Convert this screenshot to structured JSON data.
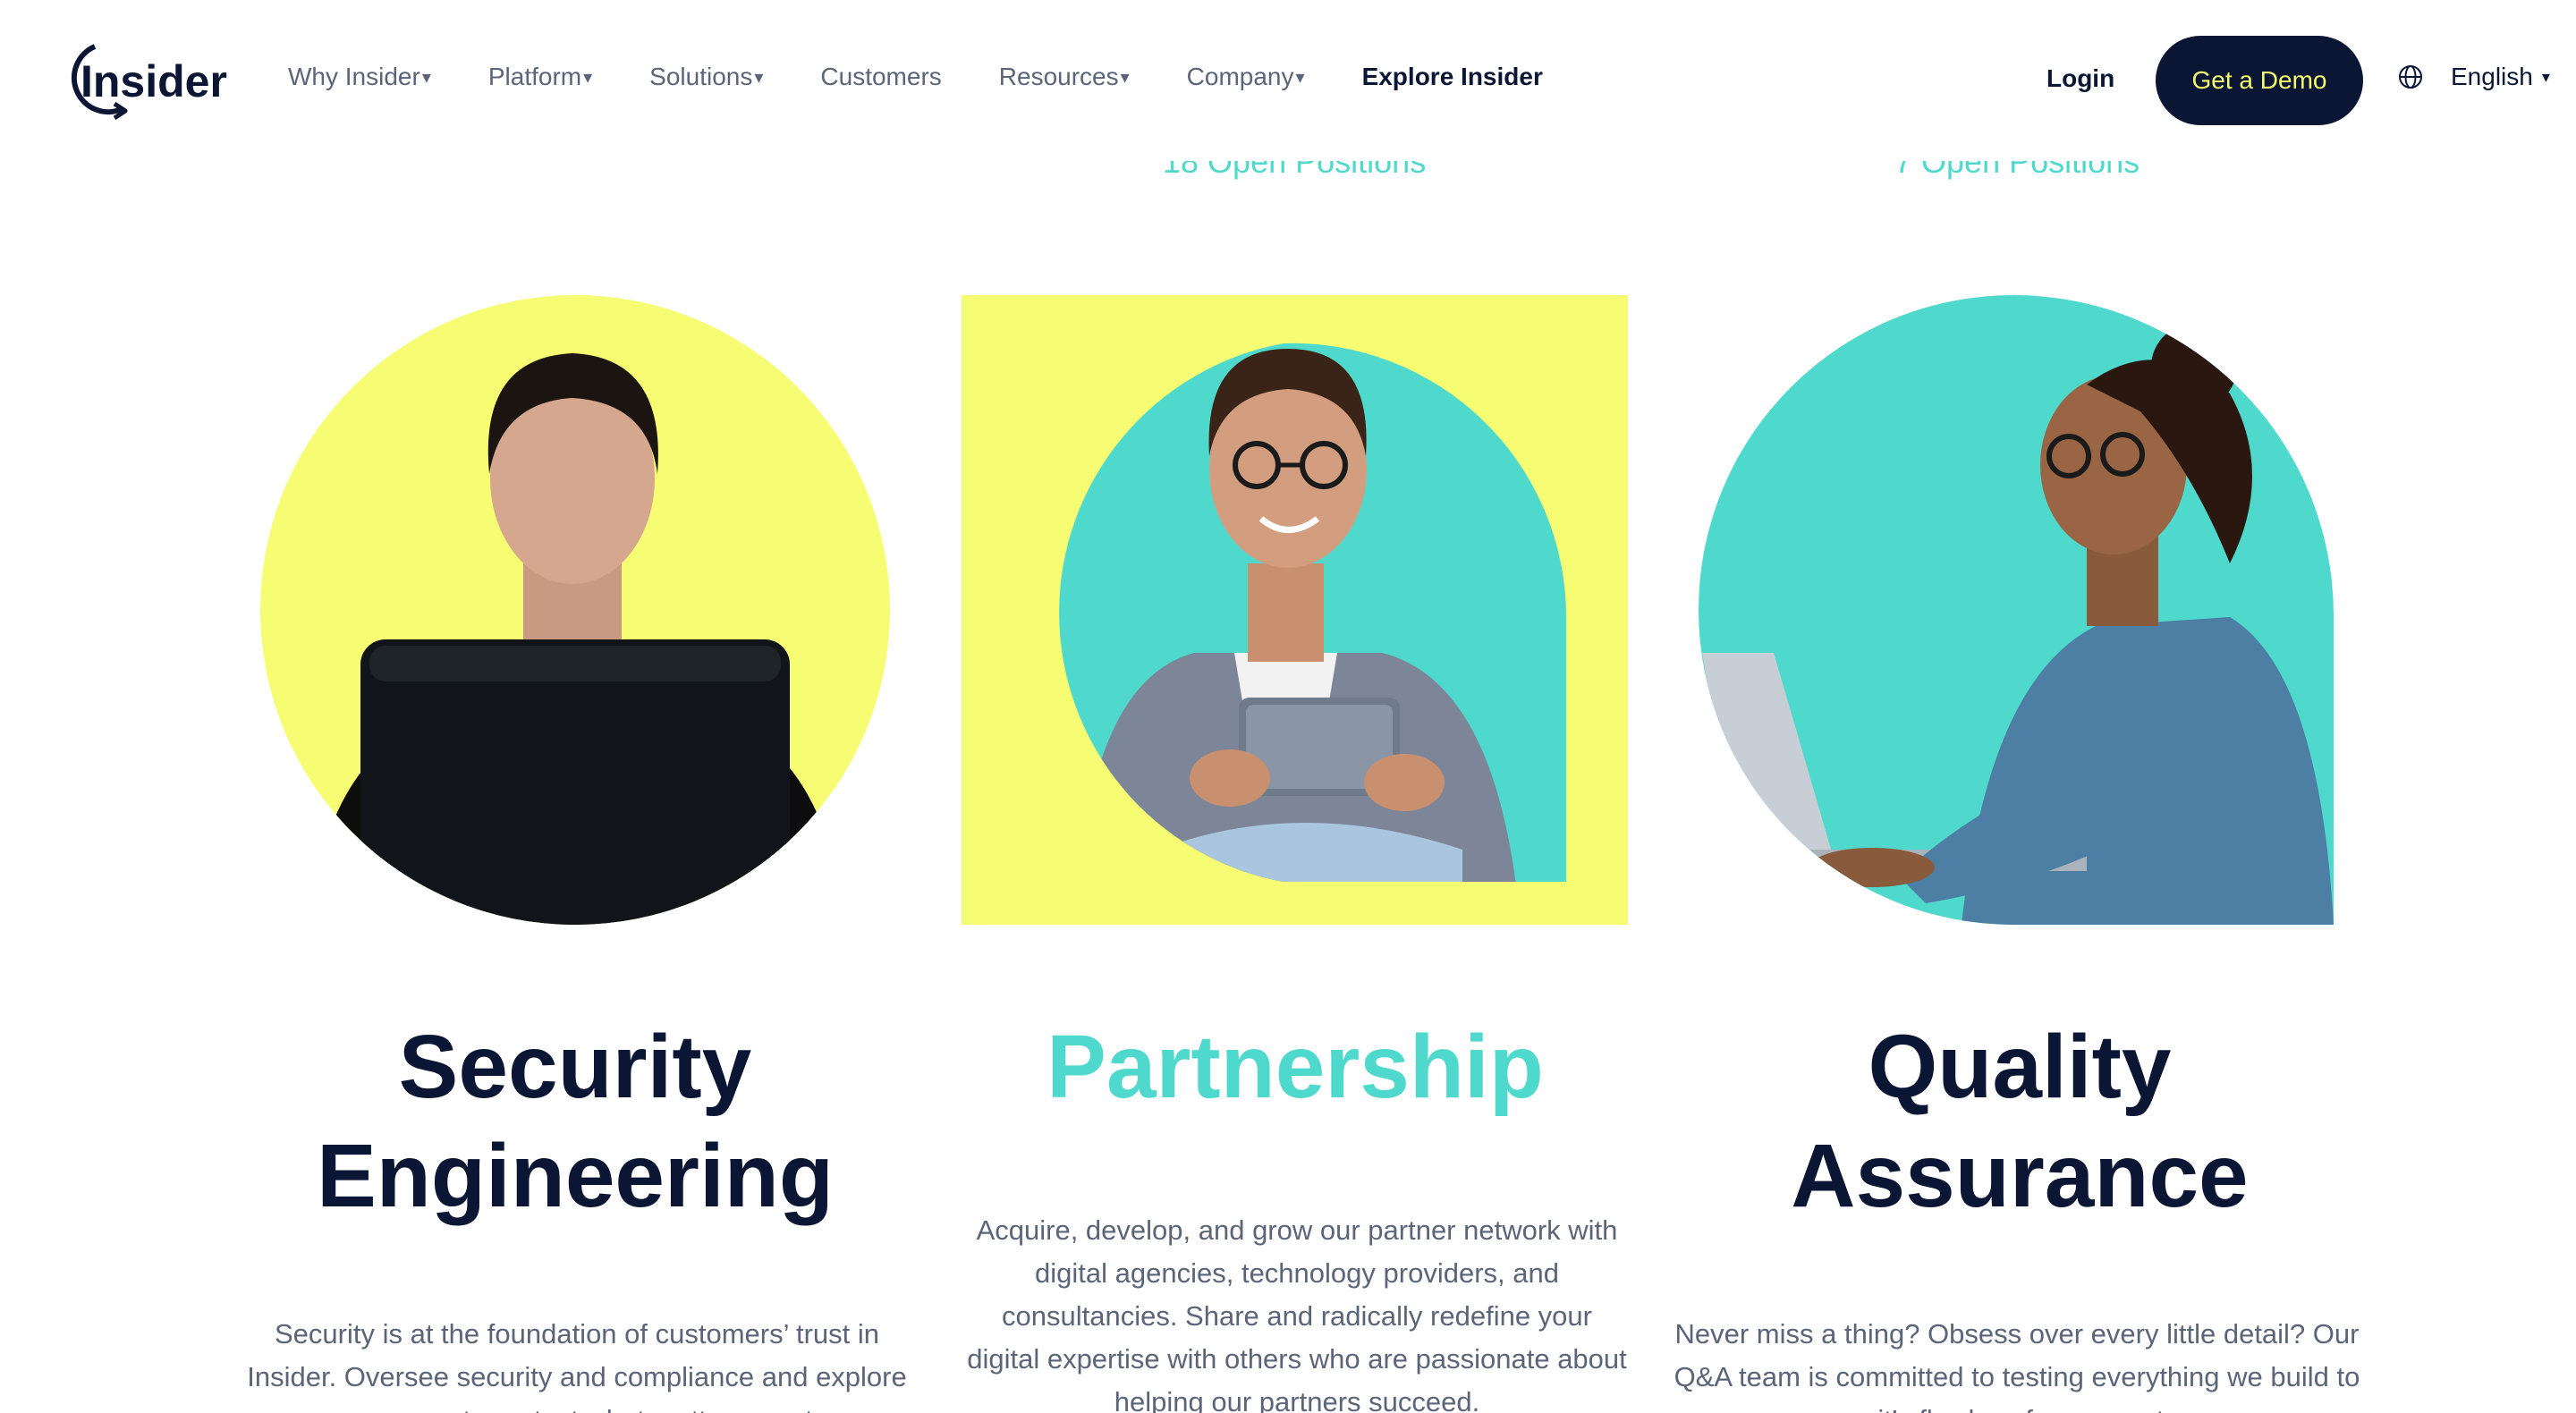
{
  "header": {
    "logo_text": "Insider",
    "nav": [
      {
        "label": "Why Insider",
        "caret": "▾"
      },
      {
        "label": "Platform",
        "caret": "▾"
      },
      {
        "label": "Solutions",
        "caret": "▾"
      },
      {
        "label": "Customers",
        "caret": ""
      },
      {
        "label": "Resources",
        "caret": "▾"
      },
      {
        "label": "Company",
        "caret": "▾"
      },
      {
        "label": "Explore Insider",
        "caret": ""
      }
    ],
    "login": "Login",
    "demo_button": "Get a Demo",
    "language": "English",
    "language_caret": "▾"
  },
  "open_positions": [
    "18 Open Positions",
    "7 Open Positions"
  ],
  "cards": [
    {
      "title_line1": "Security",
      "title_line2": "Engineering",
      "description": "Security is at the foundation of customers’ trust in Insider. Oversee security and compliance and explore new ways to protect what matters most.",
      "accent": "#f7fd72"
    },
    {
      "title_line1": "Partnership",
      "title_line2": "",
      "description": "Acquire, develop, and grow our partner network with digital agencies, technology providers, and consultancies. Share and radically redefine your digital expertise with others who are passionate about helping our partners succeed.",
      "accent": "#4fd9cd"
    },
    {
      "title_line1": "Quality",
      "title_line2": "Assurance",
      "description": "Never miss a thing? Obsess over every little detail? Our Q&A team is committed to testing everything we build to ensure it’s flawless for our customers.",
      "accent": "#4fd9cd"
    }
  ],
  "colors": {
    "navy": "#0a1633",
    "teal": "#4fd9cd",
    "yellow": "#f7fd72",
    "gray_text": "#5b6478"
  }
}
